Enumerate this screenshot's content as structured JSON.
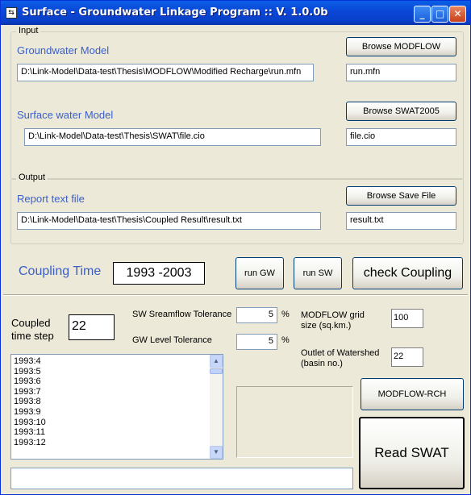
{
  "window": {
    "title": "Surface - Groundwater Linkage Program  :: V. 1.0.0b",
    "app_icon": "swap-arrows-icon",
    "controls": {
      "minimize": "_",
      "maximize": "□",
      "close": "✕"
    }
  },
  "input": {
    "legend": "Input",
    "gw_label": "Groundwater Model",
    "gw_path": "D:\\Link-Model\\Data-test\\Thesis\\MODFLOW\\Modified Recharge\\run.mfn",
    "gw_browse": "Browse MODFLOW",
    "gw_file": "run.mfn",
    "sw_label": "Surface water Model",
    "sw_path": "D:\\Link-Model\\Data-test\\Thesis\\SWAT\\file.cio",
    "sw_browse": "Browse SWAT2005",
    "sw_file": "file.cio"
  },
  "output": {
    "legend": "Output",
    "report_label": "Report text file",
    "report_path": "D:\\Link-Model\\Data-test\\Thesis\\Coupled Result\\result.txt",
    "browse_save": "Browse Save File",
    "report_file": "result.txt"
  },
  "coupling": {
    "label": "Coupling Time",
    "period": "1993 -2003",
    "run_gw": "run GW",
    "run_sw": "run SW",
    "check": "check Coupling"
  },
  "params": {
    "coupled_step_label": "Coupled\ntime step",
    "coupled_step": "22",
    "sw_tol_label": "SW Sreamflow Tolerance",
    "sw_tol": "5",
    "gw_tol_label": "GW Level Tolerance",
    "gw_tol": "5",
    "percent": "%",
    "grid_label": "MODFLOW grid\nsize (sq.km.)",
    "grid_size": "100",
    "outlet_label": "Outlet of Watershed\n(basin no.)",
    "outlet": "22"
  },
  "timesteps": [
    "1993:4",
    "1993:5",
    "1993:6",
    "1993:7",
    "1993:8",
    "1993:9",
    "1993:10",
    "1993:11",
    "1993:12"
  ],
  "buttons": {
    "modflow_rch": "MODFLOW-RCH",
    "read_swat": "Read SWAT"
  },
  "status": ""
}
